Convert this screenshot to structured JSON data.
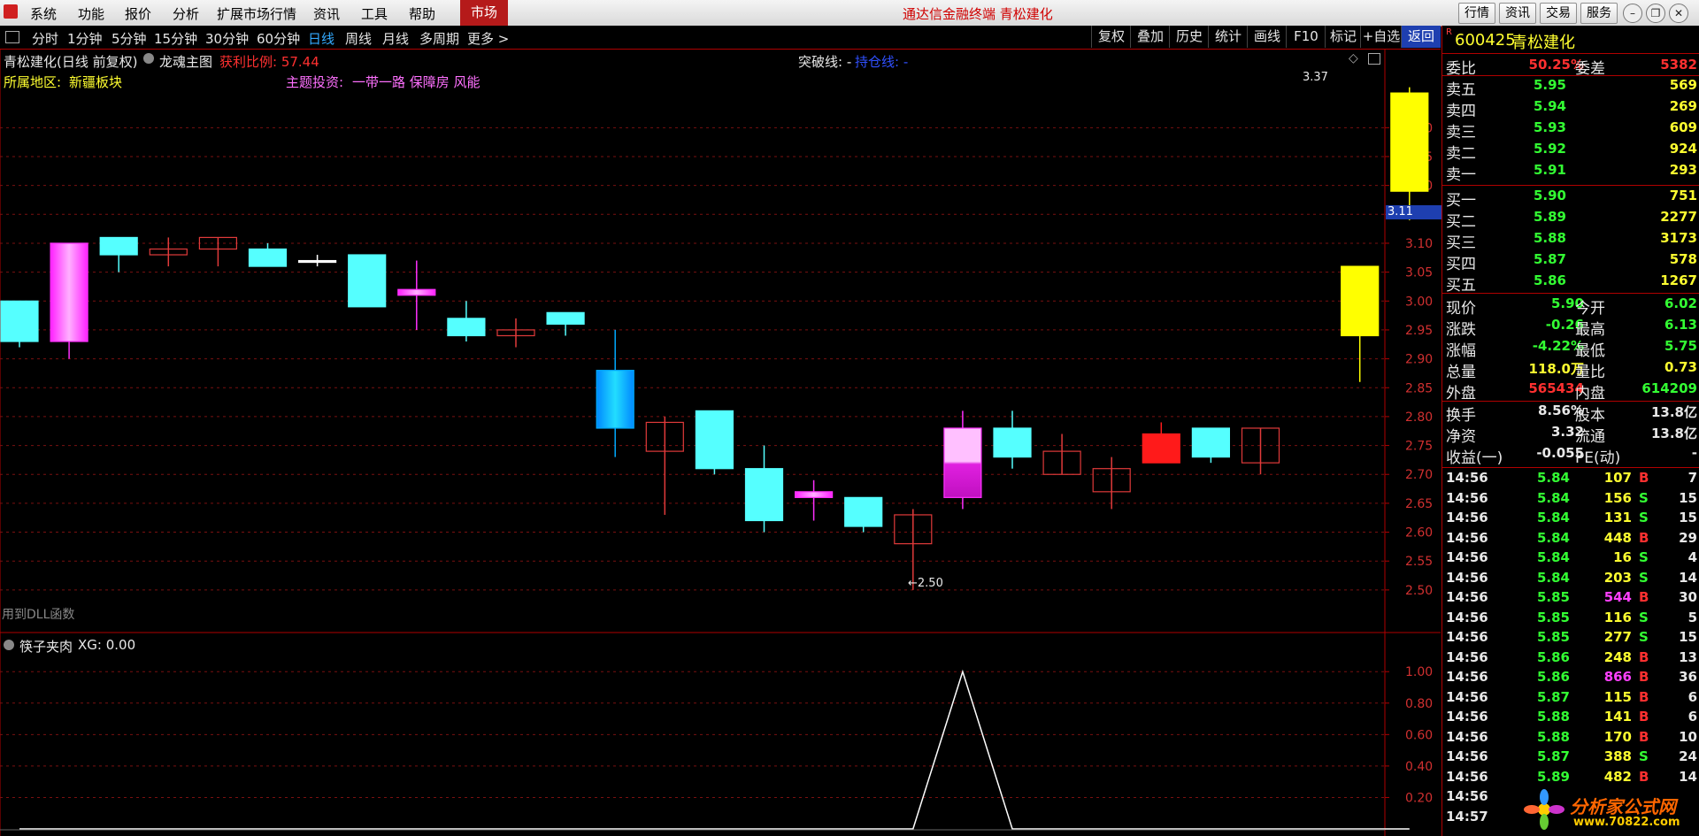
{
  "menubar": {
    "items": [
      "系统",
      "功能",
      "报价",
      "分析",
      "扩展市场行情",
      "资讯",
      "工具",
      "帮助"
    ],
    "market_tab": "市场",
    "app_title": "通达信金融终端  青松建化",
    "buttons": [
      "行情",
      "资讯",
      "交易",
      "服务"
    ],
    "window_controls": [
      "minimize-icon",
      "restore-icon",
      "close-icon"
    ]
  },
  "periodbar": {
    "periods": [
      "分时",
      "1分钟",
      "5分钟",
      "15分钟",
      "30分钟",
      "60分钟",
      "日线",
      "周线",
      "月线",
      "多周期",
      "更多 >"
    ],
    "active_period": "日线",
    "tools": [
      "复权",
      "叠加",
      "历史",
      "统计",
      "画线",
      "F10",
      "标记",
      "+自选",
      "返回"
    ],
    "active_tool": "返回"
  },
  "chart": {
    "header_name": "青松建化(日线 前复权)",
    "indicator_name": "龙魂主图",
    "profit_ratio": "获利比例: 57.44",
    "break_line_label": "突破线: -",
    "wait_line_label": "持仓线: -",
    "region_label": "所属地区:",
    "region_value": "新疆板块",
    "theme_label": "主题投资:",
    "theme_value": "一带一路 保障房 风能",
    "dll_note": "用到DLL函数",
    "high_label": "3.37",
    "low_label": "←2.50",
    "current_price_marker": "3.11",
    "sub_indicator_name": "筷子夹肉",
    "sub_indicator_value": "XG: 0.00",
    "colors": {
      "cyan": "#55ffff",
      "magenta": "#ff30ff",
      "pink": "#ffb0ff",
      "red": "#ff2020",
      "yellow": "#ffff00",
      "hollow_red": "#d03030"
    }
  },
  "chart_data": [
    {
      "type": "candlestick",
      "title": "",
      "y_ticks": [
        "3.30",
        "3.25",
        "3.20",
        "3.15",
        "3.10",
        "3.05",
        "3.00",
        "2.95",
        "2.90",
        "2.85",
        "2.80",
        "2.75",
        "2.70",
        "2.65",
        "2.60",
        "2.55",
        "2.50"
      ],
      "ylim": [
        2.46,
        3.4
      ],
      "candles": [
        {
          "open": 3.0,
          "close": 2.93,
          "high": 3.0,
          "low": 2.92,
          "style": "cyan"
        },
        {
          "open": 2.93,
          "close": 3.1,
          "high": 3.1,
          "low": 2.9,
          "style": "magenta"
        },
        {
          "open": 3.11,
          "close": 3.08,
          "high": 3.11,
          "low": 3.05,
          "style": "cyan"
        },
        {
          "open": 3.08,
          "close": 3.09,
          "high": 3.11,
          "low": 3.06,
          "style": "hollow_red"
        },
        {
          "open": 3.09,
          "close": 3.11,
          "high": 3.11,
          "low": 3.06,
          "style": "hollow_red"
        },
        {
          "open": 3.09,
          "close": 3.06,
          "high": 3.1,
          "low": 3.06,
          "style": "cyan"
        },
        {
          "open": 3.07,
          "close": 3.07,
          "high": 3.08,
          "low": 3.06,
          "style": "doji"
        },
        {
          "open": 3.08,
          "close": 2.99,
          "high": 3.08,
          "low": 2.99,
          "style": "cyan"
        },
        {
          "open": 3.02,
          "close": 3.01,
          "high": 3.07,
          "low": 2.95,
          "style": "magenta"
        },
        {
          "open": 2.97,
          "close": 2.94,
          "high": 3.0,
          "low": 2.93,
          "style": "cyan"
        },
        {
          "open": 2.94,
          "close": 2.95,
          "high": 2.97,
          "low": 2.92,
          "style": "hollow_red"
        },
        {
          "open": 2.98,
          "close": 2.96,
          "high": 2.98,
          "low": 2.94,
          "style": "cyan"
        },
        {
          "open": 2.88,
          "close": 2.78,
          "high": 2.95,
          "low": 2.73,
          "style": "blue"
        },
        {
          "open": 2.74,
          "close": 2.79,
          "high": 2.8,
          "low": 2.63,
          "style": "hollow_red"
        },
        {
          "open": 2.81,
          "close": 2.71,
          "high": 2.81,
          "low": 2.7,
          "style": "cyan"
        },
        {
          "open": 2.71,
          "close": 2.62,
          "high": 2.75,
          "low": 2.6,
          "style": "cyan"
        },
        {
          "open": 2.67,
          "close": 2.66,
          "high": 2.69,
          "low": 2.62,
          "style": "magenta"
        },
        {
          "open": 2.66,
          "close": 2.61,
          "high": 2.66,
          "low": 2.6,
          "style": "cyan"
        },
        {
          "open": 2.58,
          "close": 2.63,
          "high": 2.64,
          "low": 2.5,
          "style": "hollow_red"
        },
        {
          "open": 2.78,
          "close": 2.66,
          "high": 2.81,
          "low": 2.64,
          "style": "pink"
        },
        {
          "open": 2.78,
          "close": 2.73,
          "high": 2.81,
          "low": 2.71,
          "style": "cyan"
        },
        {
          "open": 2.7,
          "close": 2.74,
          "high": 2.77,
          "low": 2.7,
          "style": "hollow_red"
        },
        {
          "open": 2.67,
          "close": 2.71,
          "high": 2.73,
          "low": 2.64,
          "style": "hollow_red"
        },
        {
          "open": 2.72,
          "close": 2.77,
          "high": 2.79,
          "low": 2.72,
          "style": "red"
        },
        {
          "open": 2.78,
          "close": 2.73,
          "high": 2.78,
          "low": 2.72,
          "style": "cyan"
        },
        {
          "open": 2.72,
          "close": 2.78,
          "high": 2.78,
          "low": 2.7,
          "style": "hollow_red"
        },
        null,
        {
          "open": 2.94,
          "close": 3.06,
          "high": 3.06,
          "low": 2.86,
          "style": "yellow"
        },
        {
          "open": 3.19,
          "close": 3.36,
          "high": 3.37,
          "low": 3.14,
          "style": "yellow"
        }
      ]
    },
    {
      "type": "line",
      "title": "筷子夹肉",
      "y_ticks": [
        "1.00",
        "0.80",
        "0.60",
        "0.40",
        "0.20"
      ],
      "ylim": [
        0,
        1.08
      ],
      "series": [
        {
          "name": "XG",
          "values": [
            0,
            0,
            0,
            0,
            0,
            0,
            0,
            0,
            0,
            0,
            0,
            0,
            0,
            0,
            0,
            0,
            0,
            0,
            0,
            1,
            0,
            0,
            0,
            0,
            0,
            0,
            0,
            0,
            0
          ]
        }
      ]
    }
  ],
  "panel": {
    "code": "600425",
    "name": "青松建化",
    "r_badge": "R",
    "weibi_label": "委比",
    "weibi_value": "50.25%",
    "weicha_label": "委差",
    "weicha_value": "5382",
    "asks": [
      {
        "label": "卖五",
        "price": "5.95",
        "vol": "569"
      },
      {
        "label": "卖四",
        "price": "5.94",
        "vol": "269"
      },
      {
        "label": "卖三",
        "price": "5.93",
        "vol": "609"
      },
      {
        "label": "卖二",
        "price": "5.92",
        "vol": "924"
      },
      {
        "label": "卖一",
        "price": "5.91",
        "vol": "293"
      }
    ],
    "bids": [
      {
        "label": "买一",
        "price": "5.90",
        "vol": "751"
      },
      {
        "label": "买二",
        "price": "5.89",
        "vol": "2277"
      },
      {
        "label": "买三",
        "price": "5.88",
        "vol": "3173"
      },
      {
        "label": "买四",
        "price": "5.87",
        "vol": "578"
      },
      {
        "label": "买五",
        "price": "5.86",
        "vol": "1267"
      }
    ],
    "quote": [
      {
        "l1": "现价",
        "v1": "5.90",
        "l2": "今开",
        "v2": "6.02",
        "c1": "green",
        "c2": "green"
      },
      {
        "l1": "涨跌",
        "v1": "-0.26",
        "l2": "最高",
        "v2": "6.13",
        "c1": "green",
        "c2": "green"
      },
      {
        "l1": "涨幅",
        "v1": "-4.22%",
        "l2": "最低",
        "v2": "5.75",
        "c1": "green",
        "c2": "green"
      },
      {
        "l1": "总量",
        "v1": "118.0万",
        "l2": "量比",
        "v2": "0.73",
        "c1": "yellow",
        "c2": "yellow"
      },
      {
        "l1": "外盘",
        "v1": "565434",
        "l2": "内盘",
        "v2": "614209",
        "c1": "red",
        "c2": "green"
      }
    ],
    "fundamentals": [
      {
        "l1": "换手",
        "v1": "8.56%",
        "l2": "股本",
        "v2": "13.8亿"
      },
      {
        "l1": "净资",
        "v1": "3.32",
        "l2": "流通",
        "v2": "13.8亿"
      },
      {
        "l1": "收益(一)",
        "v1": "-0.055",
        "l2": "PE(动)",
        "v2": "-"
      }
    ],
    "trades": [
      {
        "time": "14:56",
        "price": "5.84",
        "vol": "107",
        "side": "B",
        "n": "7",
        "vc": "yellow"
      },
      {
        "time": "14:56",
        "price": "5.84",
        "vol": "156",
        "side": "S",
        "n": "15",
        "vc": "yellow"
      },
      {
        "time": "14:56",
        "price": "5.84",
        "vol": "131",
        "side": "S",
        "n": "15",
        "vc": "yellow"
      },
      {
        "time": "14:56",
        "price": "5.84",
        "vol": "448",
        "side": "B",
        "n": "29",
        "vc": "yellow"
      },
      {
        "time": "14:56",
        "price": "5.84",
        "vol": "16",
        "side": "S",
        "n": "4",
        "vc": "yellow"
      },
      {
        "time": "14:56",
        "price": "5.84",
        "vol": "203",
        "side": "S",
        "n": "14",
        "vc": "yellow"
      },
      {
        "time": "14:56",
        "price": "5.85",
        "vol": "544",
        "side": "B",
        "n": "30",
        "vc": "magenta"
      },
      {
        "time": "14:56",
        "price": "5.85",
        "vol": "116",
        "side": "S",
        "n": "5",
        "vc": "yellow"
      },
      {
        "time": "14:56",
        "price": "5.85",
        "vol": "277",
        "side": "S",
        "n": "15",
        "vc": "yellow"
      },
      {
        "time": "14:56",
        "price": "5.86",
        "vol": "248",
        "side": "B",
        "n": "13",
        "vc": "yellow"
      },
      {
        "time": "14:56",
        "price": "5.86",
        "vol": "866",
        "side": "B",
        "n": "36",
        "vc": "magenta"
      },
      {
        "time": "14:56",
        "price": "5.87",
        "vol": "115",
        "side": "B",
        "n": "6",
        "vc": "yellow"
      },
      {
        "time": "14:56",
        "price": "5.88",
        "vol": "141",
        "side": "B",
        "n": "6",
        "vc": "yellow"
      },
      {
        "time": "14:56",
        "price": "5.88",
        "vol": "170",
        "side": "B",
        "n": "10",
        "vc": "yellow"
      },
      {
        "time": "14:56",
        "price": "5.87",
        "vol": "388",
        "side": "S",
        "n": "24",
        "vc": "yellow"
      },
      {
        "time": "14:56",
        "price": "5.89",
        "vol": "482",
        "side": "B",
        "n": "14",
        "vc": "yellow"
      },
      {
        "time": "14:56",
        "price": "",
        "vol": "",
        "side": "",
        "n": "",
        "vc": "yellow"
      },
      {
        "time": "14:57",
        "price": "",
        "vol": "",
        "side": "",
        "n": "",
        "vc": "yellow"
      }
    ]
  },
  "watermark": {
    "text": "分析家公式网",
    "url": "www.70822.com"
  }
}
